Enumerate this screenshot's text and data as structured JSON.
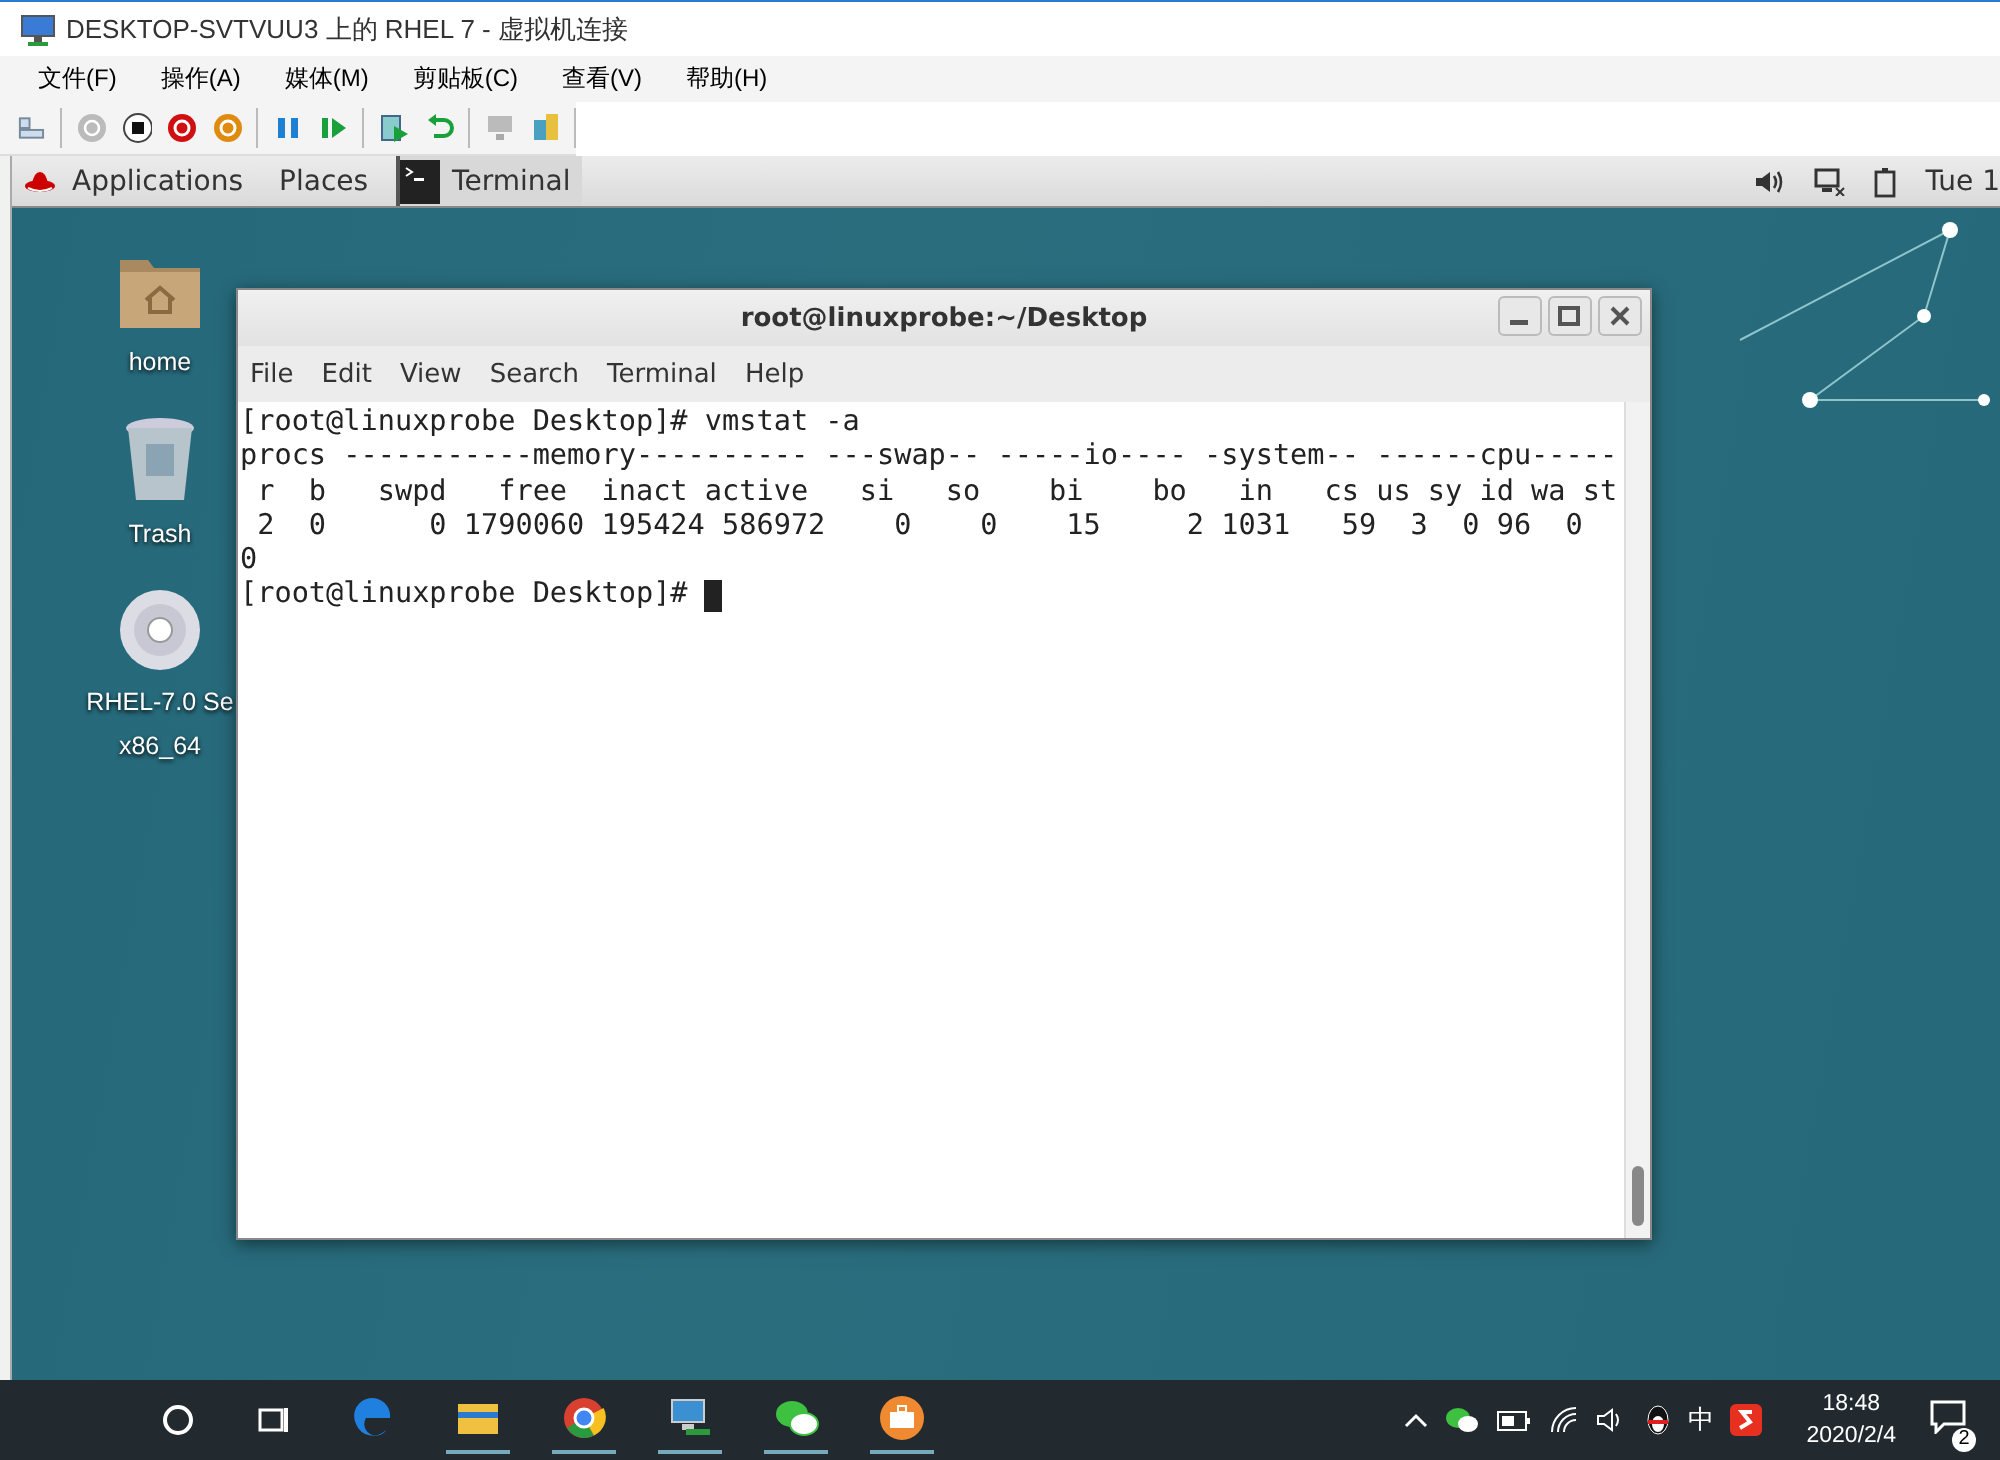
{
  "host_window": {
    "title": "DESKTOP-SVTVUU3 上的 RHEL 7 - 虚拟机连接",
    "menu": [
      "文件(F)",
      "操作(A)",
      "媒体(M)",
      "剪贴板(C)",
      "查看(V)",
      "帮助(H)"
    ]
  },
  "top_bar": {
    "applications": "Applications",
    "places": "Places",
    "active_app": "Terminal",
    "clock": "Tue 1"
  },
  "desktop_icons": [
    {
      "kind": "folder",
      "lines": [
        "home"
      ]
    },
    {
      "kind": "trash",
      "lines": [
        "Trash"
      ]
    },
    {
      "kind": "disc",
      "lines": [
        "RHEL-7.0 Se",
        "x86_64"
      ]
    }
  ],
  "terminal": {
    "title": "root@linuxprobe:~/Desktop",
    "menu": [
      "File",
      "Edit",
      "View",
      "Search",
      "Terminal",
      "Help"
    ],
    "lines": [
      "[root@linuxprobe Desktop]# vmstat -a",
      "procs -----------memory---------- ---swap-- -----io---- -system-- ------cpu-----",
      " r  b   swpd   free  inact active   si   so    bi    bo   in   cs us sy id wa st",
      " 2  0      0 1790060 195424 586972    0    0    15     2 1031   59  3  0 96  0",
      "0",
      "[root@linuxprobe Desktop]# "
    ]
  },
  "taskbar": {
    "ime": "中",
    "time": "18:48",
    "date": "2020/2/4",
    "notifications": "2"
  }
}
